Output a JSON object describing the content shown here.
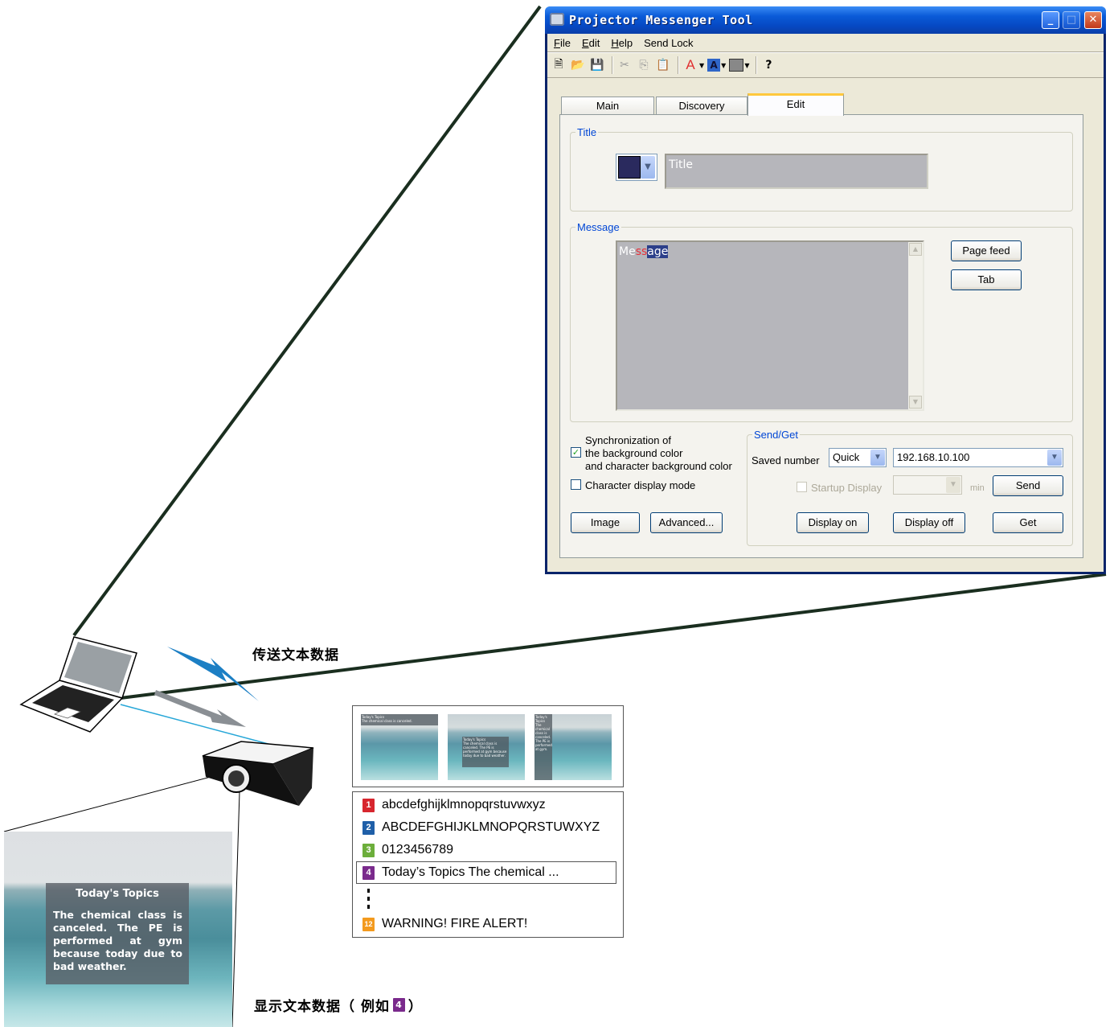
{
  "window": {
    "title": "Projector Messenger Tool",
    "menu": [
      {
        "label": "File",
        "hotkey": "F"
      },
      {
        "label": "Edit",
        "hotkey": "E"
      },
      {
        "label": "Help",
        "hotkey": "H"
      },
      {
        "label": "Send Lock",
        "hotkey": ""
      }
    ],
    "tabs": {
      "main": "Main",
      "discovery": "Discovery",
      "edit": "Edit"
    },
    "title_group": {
      "legend": "Title",
      "input_value": "Title",
      "swatch_color": "#2a2a5e"
    },
    "message_group": {
      "legend": "Message",
      "text_part1": "Me",
      "text_part2": "ss",
      "text_part3": "age",
      "page_feed": "Page feed",
      "tab": "Tab"
    },
    "options": {
      "sync_line1": "Synchronization of",
      "sync_line2": "the background color",
      "sync_line3": "and character background color",
      "sync_checked": true,
      "char_display_mode": "Character display mode",
      "char_display_checked": false,
      "image": "Image",
      "advanced": "Advanced..."
    },
    "send_get": {
      "legend": "Send/Get",
      "saved_number_label": "Saved number",
      "saved_number_value": "Quick",
      "ip_value": "192.168.10.100",
      "startup_display": "Startup Display",
      "min_label": "min",
      "send": "Send",
      "display_on": "Display on",
      "display_off": "Display off",
      "get": "Get"
    }
  },
  "illustration": {
    "send_caption": "传送文本数据",
    "display_caption_prefix": "显示文本数据（ 例如 ",
    "display_caption_num": "4",
    "display_caption_suffix": "）",
    "thumbs": [
      {
        "title": "Today's Topics",
        "text": "The chemical class is canceled."
      },
      {
        "title": "Today's Topics",
        "text": "The chemical class is canceled. The PE is performed at gym because today due to bad weather."
      },
      {
        "title": "Today's Topics",
        "text": "The chemical class is canceled. The PE is performed at gym."
      }
    ],
    "list": [
      {
        "num": "1",
        "color": "#d7262e",
        "text": "abcdefghijklmnopqrstuvwxyz"
      },
      {
        "num": "2",
        "color": "#1f5fa8",
        "text": "ABCDEFGHIJKLMNOPQRSTUWXYZ"
      },
      {
        "num": "3",
        "color": "#6cae3b",
        "text": "0123456789"
      },
      {
        "num": "4",
        "color": "#7a2a8c",
        "text": "Today’s Topics The chemical ..."
      },
      {
        "num": "12",
        "color": "#f39a1e",
        "text": "WARNING! FIRE ALERT!"
      }
    ],
    "photo": {
      "title": "Today's Topics",
      "body": "The chemical class is canceled. The PE is performed at gym because today due to bad weather."
    }
  }
}
